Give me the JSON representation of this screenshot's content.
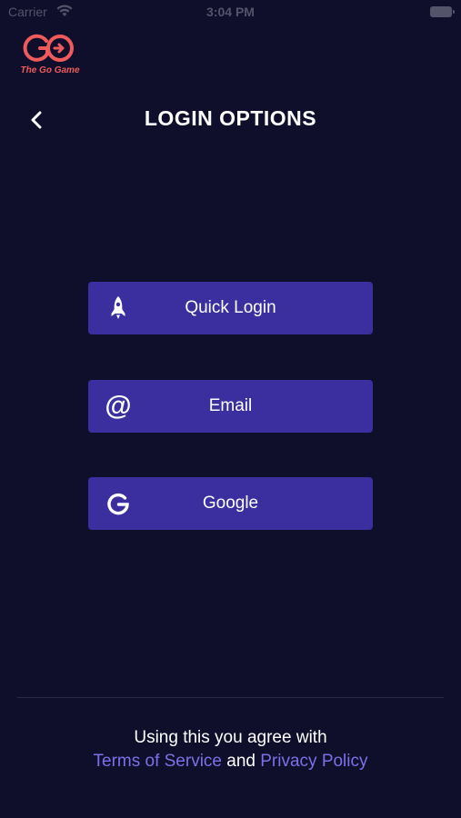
{
  "status_bar": {
    "carrier": "Carrier",
    "time": "3:04 PM"
  },
  "logo": {
    "text": "The Go Game",
    "color": "#ef5b5b"
  },
  "header": {
    "back_icon": "chevron-left-icon",
    "title": "LOGIN OPTIONS"
  },
  "login_options": [
    {
      "label": "Quick Login",
      "icon": "rocket-icon"
    },
    {
      "label": "Email",
      "icon": "at-icon"
    },
    {
      "label": "Google",
      "icon": "google-g-icon"
    }
  ],
  "footer": {
    "agree_text": "Using this you agree with",
    "terms_label": "Terms of Service",
    "and_text": "and",
    "privacy_label": "Privacy Policy"
  },
  "colors": {
    "background": "#0f0f2c",
    "button": "#3b2fa0",
    "link": "#7c70e6",
    "logo": "#ef5b5b"
  }
}
